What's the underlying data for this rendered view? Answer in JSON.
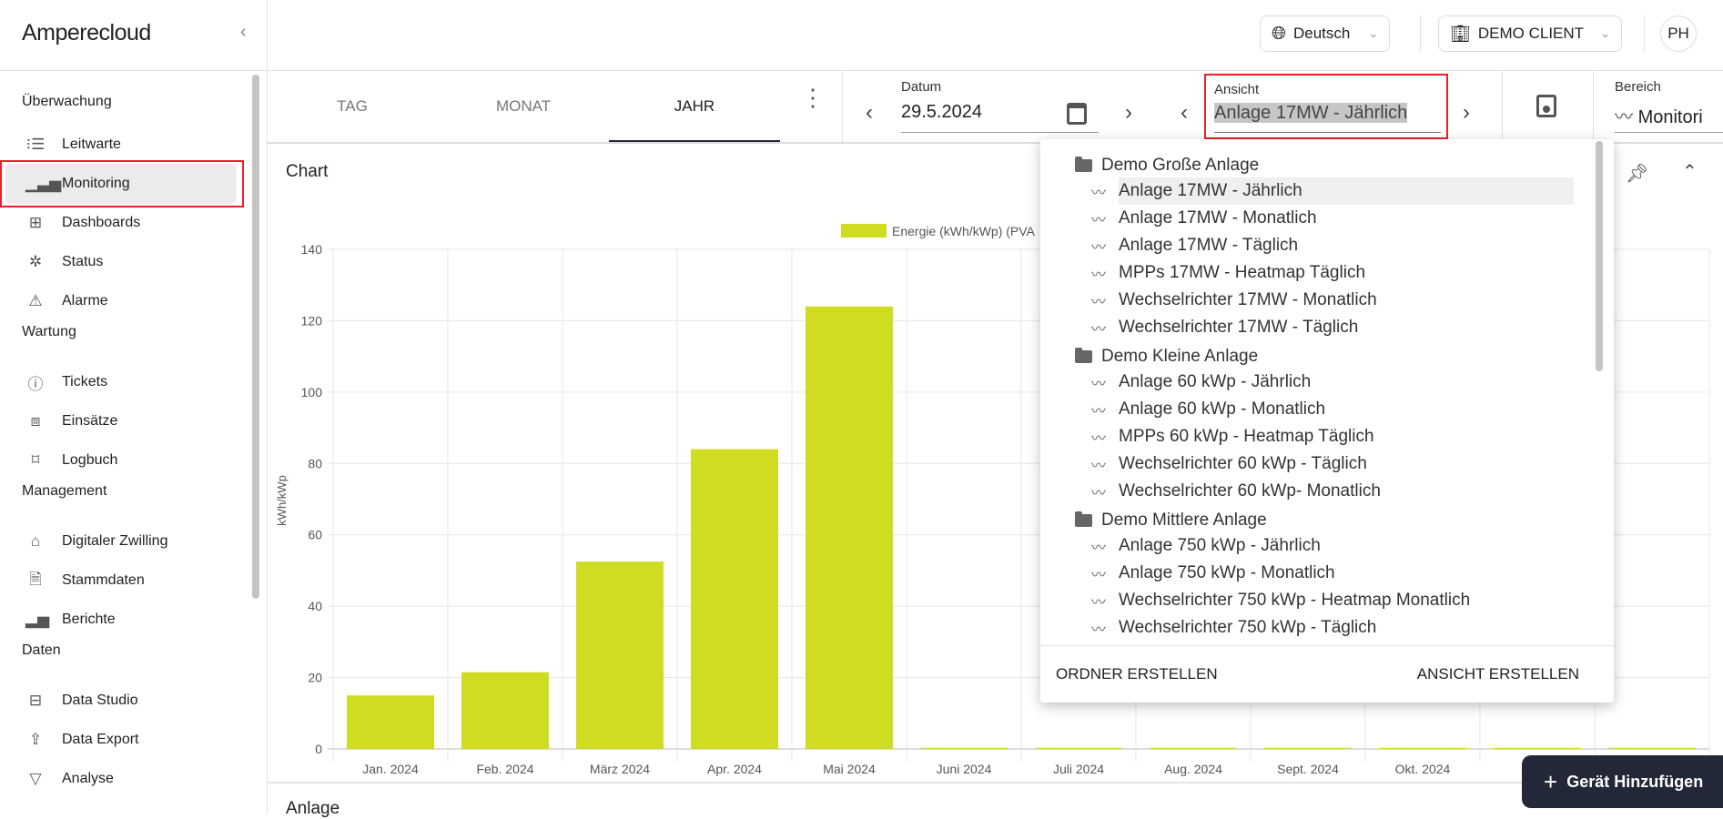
{
  "app": {
    "logo": "Amperecloud"
  },
  "header": {
    "language": "Deutsch",
    "client": "DEMO CLIENT",
    "user_initials": "PH"
  },
  "sidebar": {
    "sections": [
      {
        "title": "Überwachung",
        "items": [
          {
            "label": "Leitwarte",
            "icon": "list-icon"
          },
          {
            "label": "Monitoring",
            "icon": "signal-icon",
            "active": true
          },
          {
            "label": "Dashboards",
            "icon": "grid-icon"
          },
          {
            "label": "Status",
            "icon": "bug-icon"
          },
          {
            "label": "Alarme",
            "icon": "warning-icon"
          }
        ]
      },
      {
        "title": "Wartung",
        "items": [
          {
            "label": "Tickets",
            "icon": "alert-circle-icon"
          },
          {
            "label": "Einsätze",
            "icon": "toolbox-icon"
          },
          {
            "label": "Logbuch",
            "icon": "bookmark-icon"
          }
        ]
      },
      {
        "title": "Management",
        "items": [
          {
            "label": "Digitaler Zwilling",
            "icon": "building-icon"
          },
          {
            "label": "Stammdaten",
            "icon": "document-icon"
          },
          {
            "label": "Berichte",
            "icon": "bar-chart-icon"
          }
        ]
      },
      {
        "title": "Daten",
        "items": [
          {
            "label": "Data Studio",
            "icon": "layout-icon"
          },
          {
            "label": "Data Export",
            "icon": "upload-icon"
          },
          {
            "label": "Analyse",
            "icon": "filter-icon"
          }
        ]
      }
    ]
  },
  "tabs": [
    {
      "label": "TAG"
    },
    {
      "label": "MONAT"
    },
    {
      "label": "JAHR",
      "active": true
    }
  ],
  "toolbar": {
    "datum_label": "Datum",
    "datum_value": "29.5.2024",
    "ansicht_label": "Ansicht",
    "ansicht_value": "Anlage 17MW - Jährlich",
    "bereich_label": "Bereich",
    "bereich_value": "Monitori"
  },
  "card": {
    "title": "Chart",
    "next_title": "Anlage"
  },
  "dropdown": {
    "groups": [
      {
        "folder": "Demo Große Anlage",
        "items": [
          "Anlage 17MW - Jährlich",
          "Anlage 17MW - Monatlich",
          "Anlage 17MW - Täglich",
          "MPPs 17MW - Heatmap Täglich",
          "Wechselrichter 17MW - Monatlich",
          "Wechselrichter 17MW - Täglich"
        ]
      },
      {
        "folder": "Demo Kleine Anlage",
        "items": [
          "Anlage 60 kWp - Jährlich",
          "Anlage 60 kWp - Monatlich",
          "MPPs 60 kWp - Heatmap Täglich",
          "Wechselrichter 60 kWp - Täglich",
          "Wechselrichter 60 kWp- Monatlich"
        ]
      },
      {
        "folder": "Demo Mittlere Anlage",
        "items": [
          "Anlage 750 kWp - Jährlich",
          "Anlage 750 kWp - Monatlich",
          "Wechselrichter 750 kWp - Heatmap Monatlich",
          "Wechselrichter 750 kWp - Täglich"
        ]
      }
    ],
    "create_folder": "ORDNER ERSTELLEN",
    "create_view": "ANSICHT ERSTELLEN"
  },
  "add_device": "Gerät Hinzufügen",
  "chart_data": {
    "type": "bar",
    "categories": [
      "Jan. 2024",
      "Feb. 2024",
      "März 2024",
      "Apr. 2024",
      "Mai 2024",
      "Juni 2024",
      "Juli 2024",
      "Aug. 2024",
      "Sept. 2024",
      "Okt. 2024",
      "",
      ""
    ],
    "series": [
      {
        "name": "Energie (kWh/kWp) (PVA",
        "values": [
          15,
          21.5,
          52.5,
          84,
          124,
          0.3,
          0.3,
          0.3,
          0.3,
          0.3,
          0.3,
          0.3
        ],
        "color": "#cfdc22"
      }
    ],
    "ylabel": "kWh/kWp",
    "ylim": [
      0,
      140
    ],
    "yticks": [
      0,
      20,
      40,
      60,
      80,
      100,
      120,
      140
    ],
    "grid": true,
    "legend": "top-center"
  }
}
